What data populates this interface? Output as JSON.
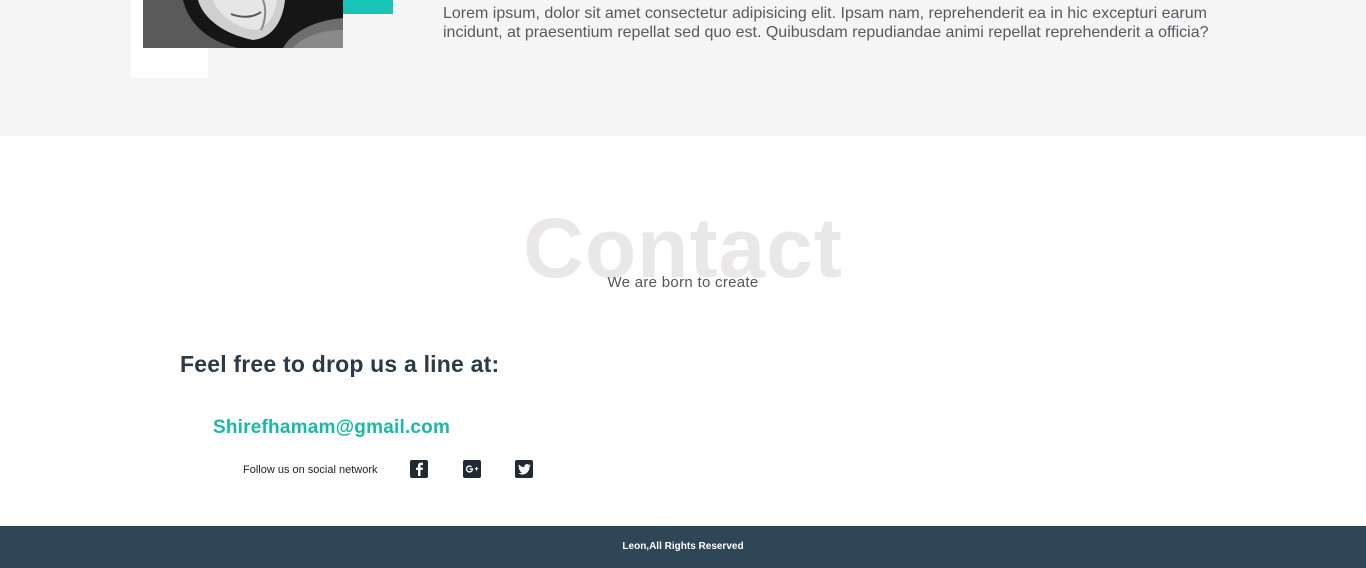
{
  "about": {
    "text": "Lorem ipsum, dolor sit amet consectetur adipisicing elit. Ipsam nam, reprehenderit ea in hic excepturi earum incidunt, at praesentium repellat sed quo est. Quibusdam repudiandae animi repellat reprehenderit a officia?",
    "accent_color": "#19c5b4"
  },
  "contact": {
    "bg_title": "Contact",
    "subtitle": "We are born to create",
    "heading": "Feel free to drop us a line at:",
    "email": "Shirefhamam@gmail.com",
    "follow_label": "Follow us on social network",
    "social": [
      {
        "icon": "facebook-icon"
      },
      {
        "icon": "google-plus-icon"
      },
      {
        "icon": "twitter-icon"
      }
    ],
    "email_color": "#19b8a8"
  },
  "footer": {
    "copyright": "Leon,All Rights Reserved",
    "bg_color": "#2e4655"
  }
}
